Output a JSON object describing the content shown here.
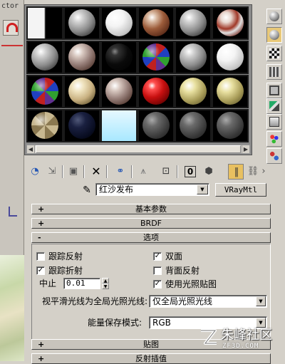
{
  "viewport": {
    "top_label": "ctor"
  },
  "material_slots": [
    {
      "material": "white-black-half",
      "selected": false
    },
    {
      "material": "grey",
      "selected": false
    },
    {
      "material": "white",
      "selected": false
    },
    {
      "material": "wood",
      "selected": false
    },
    {
      "material": "grey",
      "selected": false
    },
    {
      "material": "red-white",
      "selected": false
    },
    {
      "material": "grey",
      "selected": false
    },
    {
      "material": "stone",
      "selected": false
    },
    {
      "material": "black",
      "selected": false
    },
    {
      "material": "checker",
      "selected": false
    },
    {
      "material": "grey",
      "selected": false
    },
    {
      "material": "white",
      "selected": false
    },
    {
      "material": "checker",
      "selected": false
    },
    {
      "material": "cream",
      "selected": false
    },
    {
      "material": "stone",
      "selected": false
    },
    {
      "material": "red",
      "selected": false
    },
    {
      "material": "khaki",
      "selected": false
    },
    {
      "material": "khaki",
      "selected": false
    },
    {
      "material": "checker-cream",
      "selected": false
    },
    {
      "material": "navy",
      "selected": false
    },
    {
      "material": "sky-blue",
      "selected": false
    },
    {
      "material": "dark-grey",
      "selected": false
    },
    {
      "material": "dark-grey",
      "selected": false
    },
    {
      "material": "dark-grey",
      "selected": false
    }
  ],
  "toolbar_icons": [
    "get-material-icon",
    "put-to-scene-icon",
    "assign-to-selection-icon",
    "reset-map-icon",
    "make-copy-icon",
    "make-unique-icon",
    "put-to-library-icon",
    "material-id-channel-icon",
    "show-map-in-viewport-icon",
    "show-end-result-icon",
    "go-to-parent-icon",
    "go-forward-to-sibling-icon"
  ],
  "material": {
    "name": "红沙发布",
    "type": "VRayMtl"
  },
  "rollouts": {
    "basic_params": {
      "sign": "+",
      "title": "基本参数"
    },
    "brdf": {
      "sign": "+",
      "title": "BRDF"
    },
    "options": {
      "sign": "-",
      "title": "选项"
    },
    "maps": {
      "sign": "+",
      "title": "贴图"
    },
    "reflect_interp": {
      "sign": "+",
      "title": "反射插值"
    }
  },
  "options": {
    "trace_reflections": {
      "label": "跟踪反射",
      "checked": false
    },
    "double_sided": {
      "label": "双面",
      "checked": true
    },
    "trace_refractions": {
      "label": "跟踪折射",
      "checked": true
    },
    "reflect_backside": {
      "label": "背面反射",
      "checked": false
    },
    "use_irradiance_map": {
      "label": "使用光照贴图",
      "checked": true
    },
    "cutoff": {
      "label": "中止",
      "value": "0.01"
    },
    "glossy_rays_gi": {
      "label": "视平滑光线为全局光照光线:",
      "value": "仅全局光照光线"
    },
    "energy_mode": {
      "label": "能量保存模式:",
      "value": "RGB"
    }
  },
  "watermark": {
    "text": "朱峰社区",
    "url": "ZF3D.COM"
  }
}
